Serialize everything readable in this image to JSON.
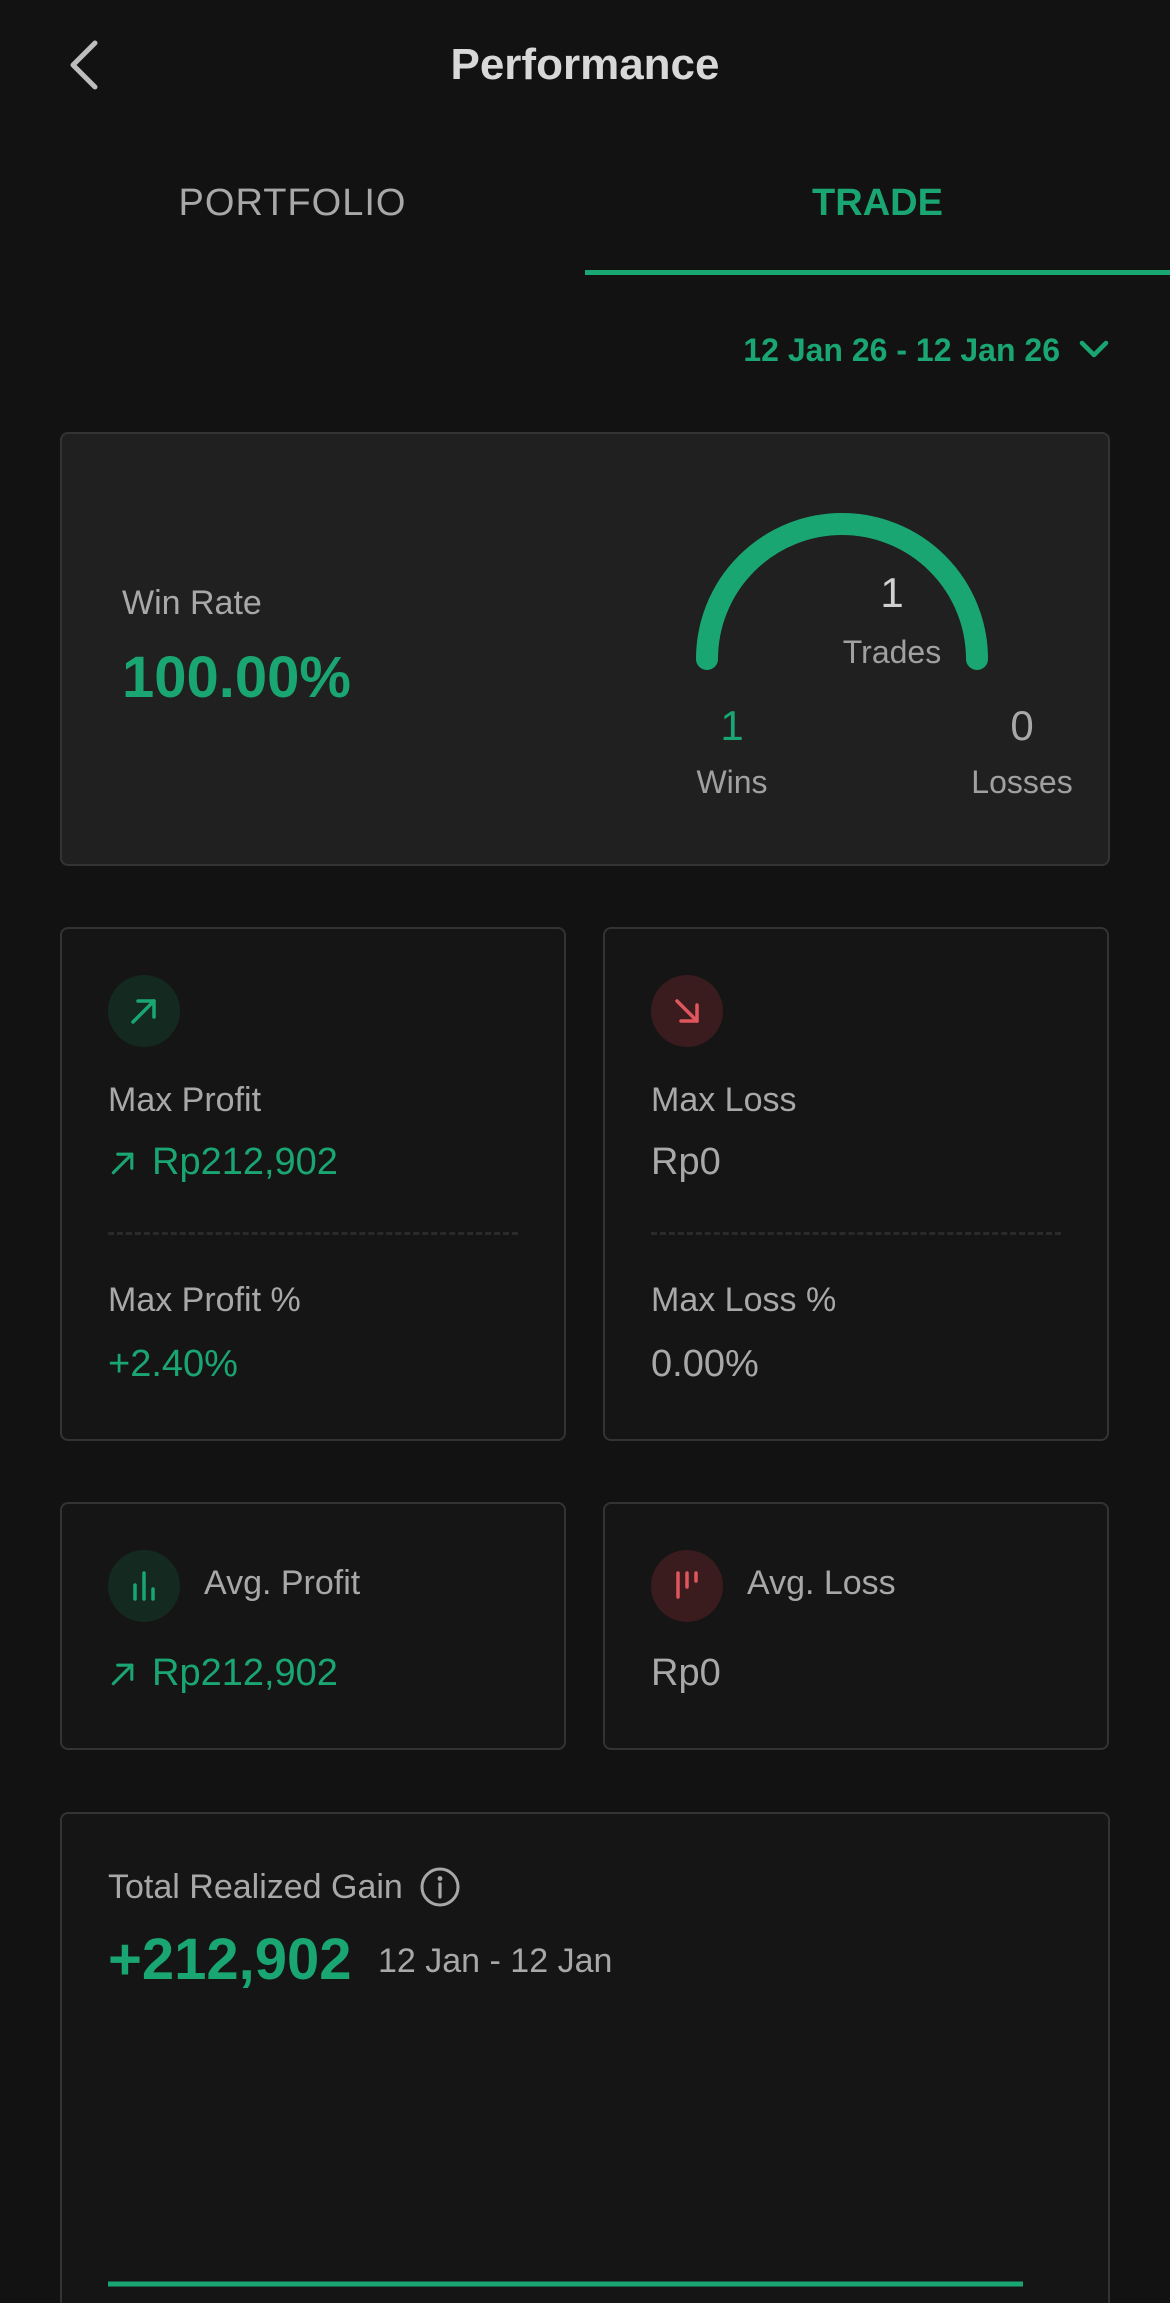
{
  "header": {
    "title": "Performance"
  },
  "tabs": [
    {
      "label": "PORTFOLIO",
      "active": false
    },
    {
      "label": "TRADE",
      "active": true
    }
  ],
  "date_range": {
    "label": "12 Jan 26 - 12 Jan 26"
  },
  "win_rate": {
    "label": "Win Rate",
    "value": "100.00%",
    "trades_count": "1",
    "trades_label": "Trades",
    "wins_count": "1",
    "wins_label": "Wins",
    "losses_count": "0",
    "losses_label": "Losses",
    "win_fraction": 1.0
  },
  "max_profit": {
    "label": "Max Profit",
    "value": "Rp212,902",
    "pct_label": "Max Profit %",
    "pct_value": "+2.40%"
  },
  "max_loss": {
    "label": "Max Loss",
    "value": "Rp0",
    "pct_label": "Max Loss %",
    "pct_value": "0.00%"
  },
  "avg_profit": {
    "label": "Avg. Profit",
    "value": "Rp212,902"
  },
  "avg_loss": {
    "label": "Avg. Loss",
    "value": "Rp0"
  },
  "total_gain": {
    "label": "Total Realized Gain",
    "value": "+212,902",
    "period": "12 Jan - 12 Jan"
  },
  "colors": {
    "accent": "#1aa673",
    "loss": "#e0565d",
    "background": "#121212",
    "card": "#202020"
  },
  "icons": {
    "back": "chevron-left-icon",
    "dropdown": "chevron-down-icon",
    "profit": "arrow-up-right-icon",
    "loss": "arrow-down-right-icon",
    "avg_profit": "bar-chart-icon",
    "avg_loss": "bar-chart-down-icon",
    "info": "info-icon"
  }
}
